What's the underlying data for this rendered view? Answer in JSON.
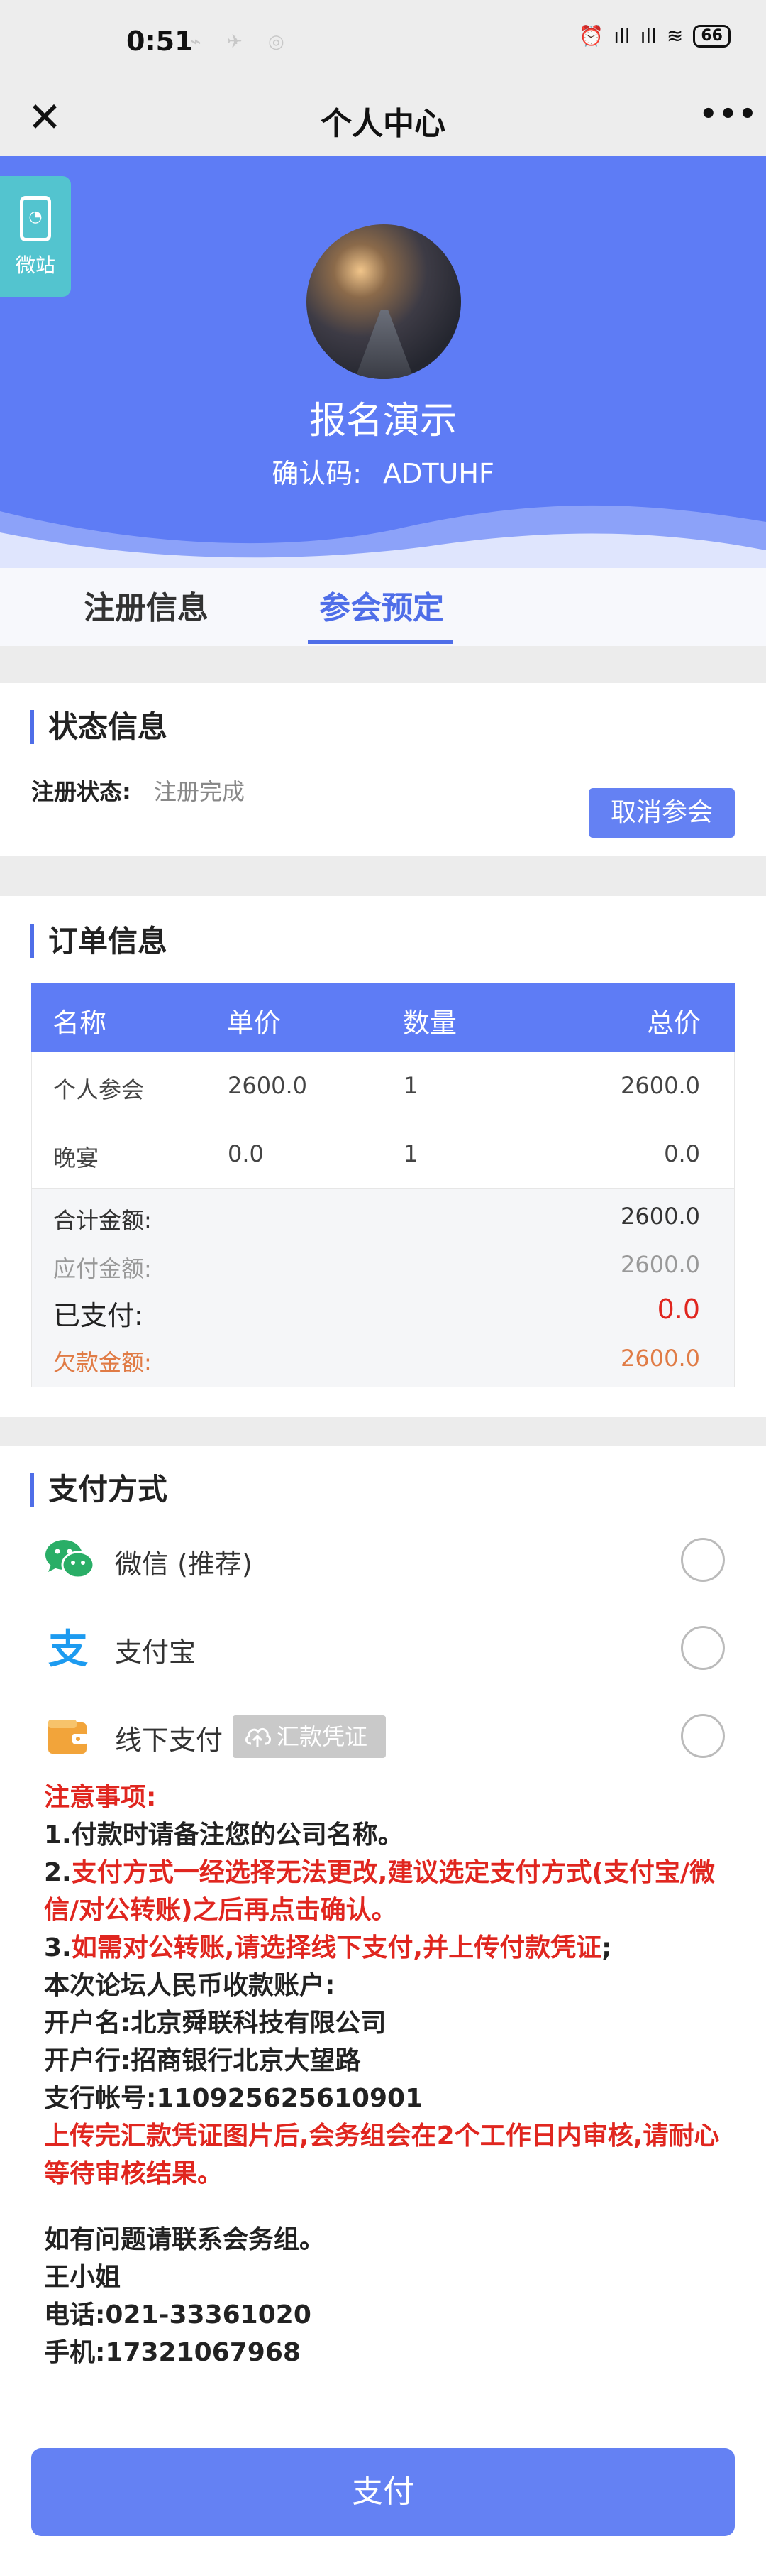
{
  "status_bar": {
    "time": "0:51",
    "battery": "66",
    "signal1": "ıll",
    "signal2": "ıll"
  },
  "nav": {
    "title": "个人中心"
  },
  "hero": {
    "weizhan_label": "微站",
    "name": "报名演示",
    "confirm_code_label": "确认码:",
    "confirm_code": "ADTUHF"
  },
  "tabs": [
    {
      "label": "注册信息",
      "active": false
    },
    {
      "label": "参会预定",
      "active": true
    }
  ],
  "status_section": {
    "title": "状态信息",
    "reg_status_label": "注册状态:",
    "reg_status_value": "注册完成",
    "cancel_button": "取消参会"
  },
  "order_section": {
    "title": "订单信息",
    "columns": [
      "名称",
      "单价",
      "数量",
      "总价"
    ],
    "rows": [
      [
        "个人参会",
        "2600.0",
        "1",
        "2600.0"
      ],
      [
        "晚宴",
        "0.0",
        "1",
        "0.0"
      ]
    ],
    "summary": {
      "total_label": "合计金额:",
      "total_value": "2600.0",
      "due_label": "应付金额:",
      "due_value": "2600.0",
      "paid_label": "已支付:",
      "paid_value": "0.0",
      "owed_label": "欠款金额:",
      "owed_value": "2600.0"
    }
  },
  "payment_section": {
    "title": "支付方式",
    "options": [
      {
        "label": "微信 (推荐)",
        "icon": "wechat-icon"
      },
      {
        "label": "支付宝",
        "icon": "alipay-icon"
      },
      {
        "label": "线下支付",
        "icon": "wallet-icon"
      }
    ],
    "upload_button": "汇款凭证"
  },
  "notes": {
    "heading": "注意事项:",
    "line1": "1.付款时请备注您的公司名称。",
    "line2_num": "2.",
    "line2": "支付方式一经选择无法更改,建议选定支付方式(支付宝/微信/对公转账)之后再点击确认。",
    "line3_num": "3.",
    "line3": "如需对公转账,请选择线下支付,并上传付款凭证",
    "line3_tail": ";",
    "account_title": "本次论坛人民币收款账户:",
    "account_name": "开户名:北京舜联科技有限公司",
    "bank": "开户行:招商银行北京大望路",
    "account_no": "支行帐号:110925625610901",
    "review_note": "上传完汇款凭证图片后,会务组会在2个工作日内审核,请耐心等待审核结果。",
    "contact_title": "如有问题请联系会务组。",
    "contact_name": "王小姐",
    "phone": "电话:021-33361020",
    "mobile": "手机:17321067968"
  },
  "pay_button": "支付",
  "colors": {
    "primary": "#5e7cf5",
    "accent_red": "#e0261f",
    "owed_orange": "#e07b45",
    "wechat_green": "#2aae67",
    "alipay_blue": "#1d9bf0"
  }
}
